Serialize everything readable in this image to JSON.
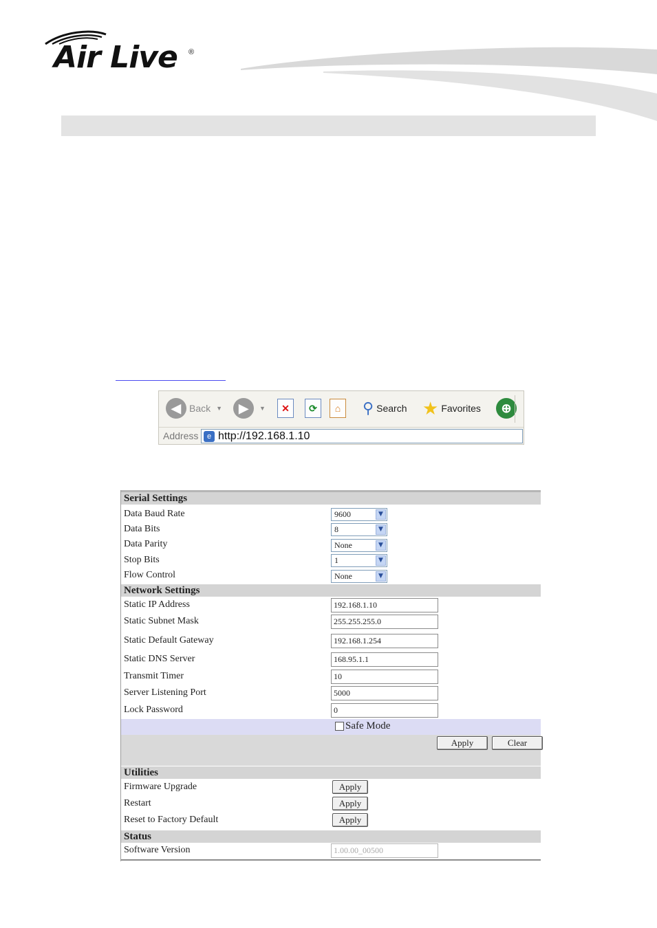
{
  "brand": {
    "name": "Air Live",
    "registered_mark": "®"
  },
  "browser": {
    "back_label": "Back",
    "search_label": "Search",
    "favorites_label": "Favorites",
    "address_label": "Address",
    "address_url": "http://192.168.1.10"
  },
  "settings": {
    "serial": {
      "title": "Serial Settings",
      "rows": [
        {
          "label": "Data Baud Rate",
          "value": "9600"
        },
        {
          "label": "Data Bits",
          "value": "8"
        },
        {
          "label": "Data Parity",
          "value": "None"
        },
        {
          "label": "Stop Bits",
          "value": "1"
        },
        {
          "label": "Flow Control",
          "value": "None"
        }
      ]
    },
    "network": {
      "title": "Network Settings",
      "rows": [
        {
          "label": "Static IP Address",
          "value": "192.168.1.10"
        },
        {
          "label": "Static Subnet Mask",
          "value": "255.255.255.0"
        },
        {
          "label": "Static Default Gateway",
          "value": "192.168.1.254"
        },
        {
          "label": "Static DNS Server",
          "value": "168.95.1.1"
        },
        {
          "label": "Transmit Timer",
          "value": "10"
        },
        {
          "label": "Server Listening Port",
          "value": "5000"
        },
        {
          "label": "Lock Password",
          "value": "0"
        }
      ],
      "safe_mode_label": "Safe Mode",
      "apply_label": "Apply",
      "clear_label": "Clear"
    },
    "utilities": {
      "title": "Utilities",
      "rows": [
        {
          "label": "Firmware Upgrade",
          "button": "Apply"
        },
        {
          "label": "Restart",
          "button": "Apply"
        },
        {
          "label": "Reset to Factory Default",
          "button": "Apply"
        }
      ]
    },
    "status": {
      "title": "Status",
      "software_version_label": "Software Version",
      "software_version_value": "1.00.00_00500"
    }
  }
}
